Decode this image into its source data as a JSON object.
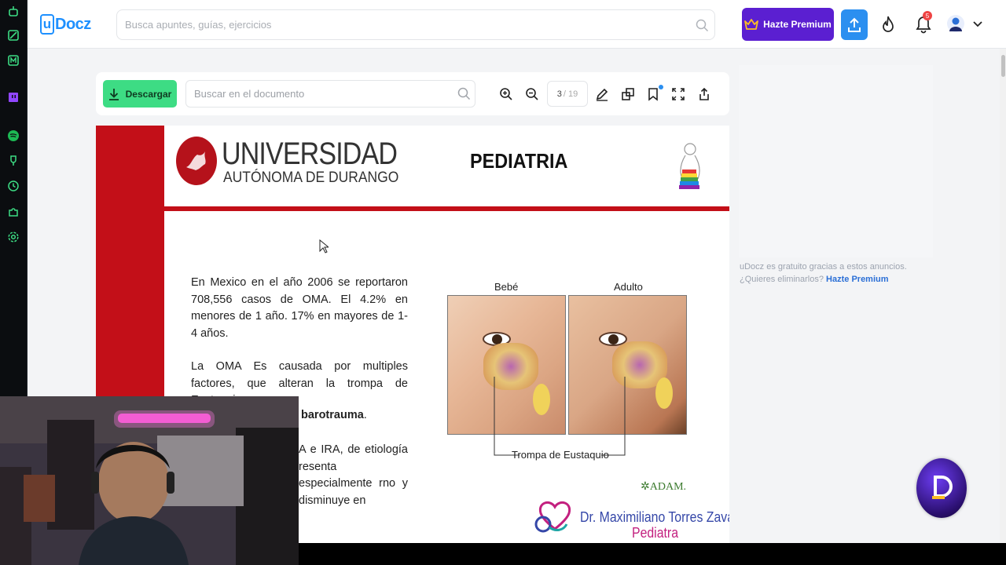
{
  "app": {
    "logo_u": "u",
    "logo_rest": "Docz"
  },
  "header": {
    "search_placeholder": "Busca apuntes, guías, ejercicios",
    "premium_label": "Hazte Premium",
    "notification_count": "5"
  },
  "sidebar": {
    "icons": [
      "robot-icon",
      "notes-icon",
      "m-app-icon",
      "twitch-icon",
      "spotify-icon",
      "trophy-icon",
      "clock-icon",
      "puzzle-icon",
      "settings-icon"
    ]
  },
  "toolbar": {
    "download_label": "Descargar",
    "search_placeholder": "Buscar en el documento",
    "current_page": "3",
    "total_pages": "/ 19"
  },
  "document": {
    "university_line1": "UNIVERSIDAD",
    "university_line2": "AUTÓNOMA DE DURANGO",
    "title": "PEDIATRIA",
    "paragraph1": "En Mexico en el año 2006 se reportaron 708,556 casos de OMA. El 4.2% en menores de 1 año. 17% en mayores de 1-4 años.",
    "paragraph2": "La OMA Es causada por multiples factores, que alteran la trompa de Eustaquio.:",
    "partial_bold": "barotrauma",
    "partial_bold_suffix": ".",
    "partial_text": "A e IRA, de etiología resenta especialmente rno y disminuye en",
    "label_baby": "Bebé",
    "label_adult": "Adulto",
    "caption": "Trompa de Eustaquio",
    "adam": "ADAM.",
    "doctor_line1": "Dr. Maximiliano Torres Zavala",
    "doctor_line2": "Pediatra"
  },
  "ad": {
    "text": "uDocz es gratuito gracias a estos anuncios. ¿Quieres eliminarlos?",
    "link": "Hazte Premium"
  },
  "colors": {
    "brand_blue": "#1e90ff",
    "premium_purple": "#5b1fd1",
    "download_green": "#3ddc84",
    "doc_red": "#c30f18"
  }
}
